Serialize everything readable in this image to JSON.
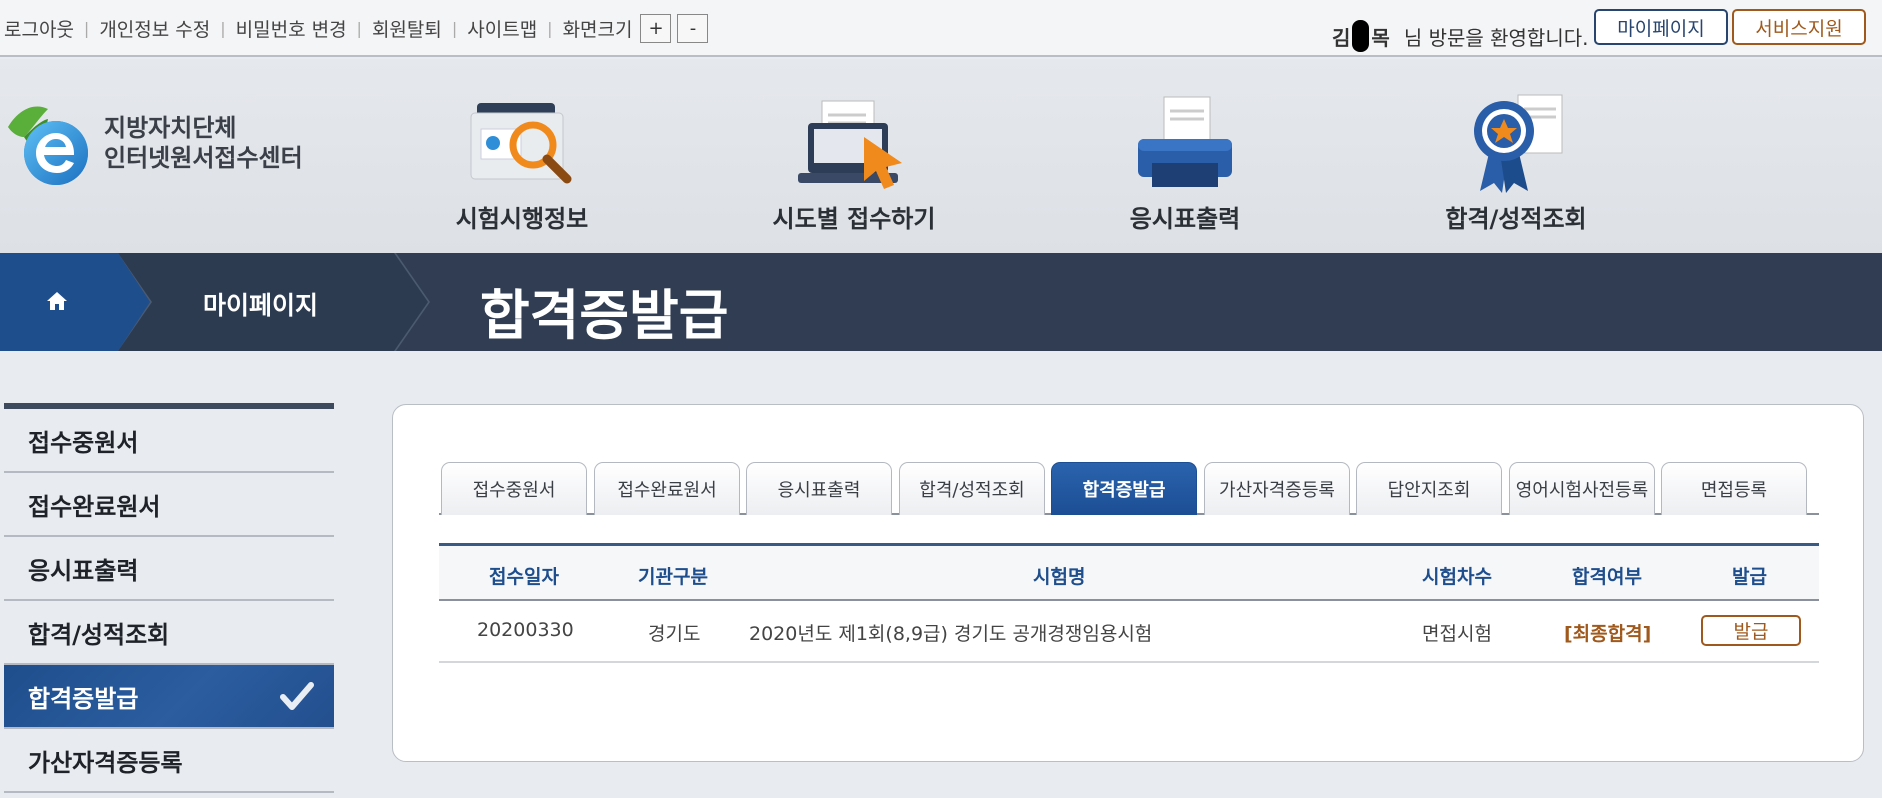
{
  "util_links": [
    "로그아웃",
    "개인정보 수정",
    "비밀번호 변경",
    "회원탈퇴",
    "사이트맵",
    "화면크기"
  ],
  "zoom": {
    "plus": "+",
    "minus": "-"
  },
  "welcome": {
    "name_first": "김",
    "name_last": "목",
    "text": "님 방문을 환영합니다."
  },
  "top_buttons": {
    "mypage": "마이페이지",
    "support": "서비스지원"
  },
  "logo": {
    "line1": "지방자치단체",
    "line2": "인터넷원서접수센터"
  },
  "main_menu": [
    "시험시행정보",
    "시도별 접수하기",
    "응시표출력",
    "합격/성적조회"
  ],
  "breadcrumb": {
    "section": "마이페이지",
    "page_title": "합격증발급"
  },
  "sidebar": {
    "items": [
      "접수중원서",
      "접수완료원서",
      "응시표출력",
      "합격/성적조회",
      "합격증발급",
      "가산자격증등록"
    ],
    "active_index": 4
  },
  "tabs": {
    "items": [
      "접수중원서",
      "접수완료원서",
      "응시표출력",
      "합격/성적조회",
      "합격증발급",
      "가산자격증등록",
      "답안지조회",
      "영어시험사전등록",
      "면접등록"
    ],
    "active_index": 4
  },
  "table": {
    "headers": [
      "접수일자",
      "기관구분",
      "시험명",
      "시험차수",
      "합격여부",
      "발급"
    ],
    "rows": [
      {
        "date": "20200330",
        "org": "경기도",
        "exam": "2020년도 제1회(8,9급) 경기도 공개경쟁임용시험",
        "round": "면접시험",
        "result": "[최종합격]",
        "action": "발급"
      }
    ]
  },
  "colors": {
    "navy": "#303d52",
    "blue": "#1f4e8c",
    "orange": "#a0591c"
  }
}
